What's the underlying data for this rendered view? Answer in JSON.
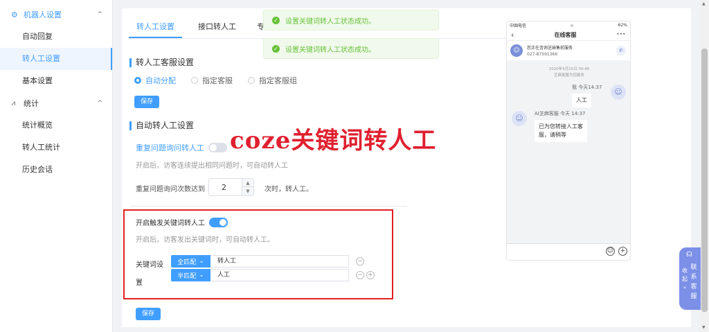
{
  "sidebar": {
    "groups": [
      {
        "label": "机器人设置",
        "items": [
          "自动回复",
          "转人工设置",
          "基本设置"
        ]
      },
      {
        "label": "统计",
        "items": [
          "统计概览",
          "转人工统计",
          "历史会话"
        ]
      }
    ]
  },
  "tabs": [
    "转人工设置",
    "接口转人工",
    "专"
  ],
  "section1": {
    "title": "转人工客服设置",
    "radios": [
      "自动分配",
      "指定客服",
      "指定客服组"
    ],
    "save": "保存"
  },
  "section2": {
    "title": "自动转人工设置",
    "repeat_label": "重复问题询问转人工",
    "repeat_hint": "开启后，访客连续提出相同问题时，可自动转人工",
    "count_label": "重复问题询问次数达到",
    "count_value": "2",
    "count_suffix": "次时，转人工。"
  },
  "keyword": {
    "label": "开启触发关键词转人工",
    "hint": "开启后，访客发出关键词时，可自动转人工。",
    "setting_label_1": "关键词设",
    "setting_label_2": "置",
    "rows": [
      {
        "mode": "全匹配",
        "value": "转人工"
      },
      {
        "mode": "半匹配",
        "value": "人工"
      }
    ],
    "save": "保存"
  },
  "toasts": [
    "设置关键词转人工状态成功。",
    "设置关键词转人工状态成功。"
  ],
  "caption": "coze关键词转人工",
  "phone": {
    "carrier": "中国电信",
    "battery": "62%",
    "title": "在线客服",
    "info_title": "您正在咨询芝麻售前服务",
    "info_phone": "027-87591366",
    "sys_date": "2020年5月15日 09:46",
    "sys_note": "芝麻客服为您服务",
    "me_meta": "我 今天14:37",
    "me_msg": "人工",
    "bot_meta": "AI芝麻客服 今天 14:37",
    "bot_msg_1": "已为您转接人工客",
    "bot_msg_2": "服，请稍等"
  },
  "contact_widget": {
    "collapse_1": "收",
    "collapse_2": "起",
    "label": [
      "联",
      "系",
      "客",
      "服"
    ]
  },
  "colors": {
    "accent": "#409eff",
    "success": "#67c23a",
    "highlight": "#e02020"
  }
}
